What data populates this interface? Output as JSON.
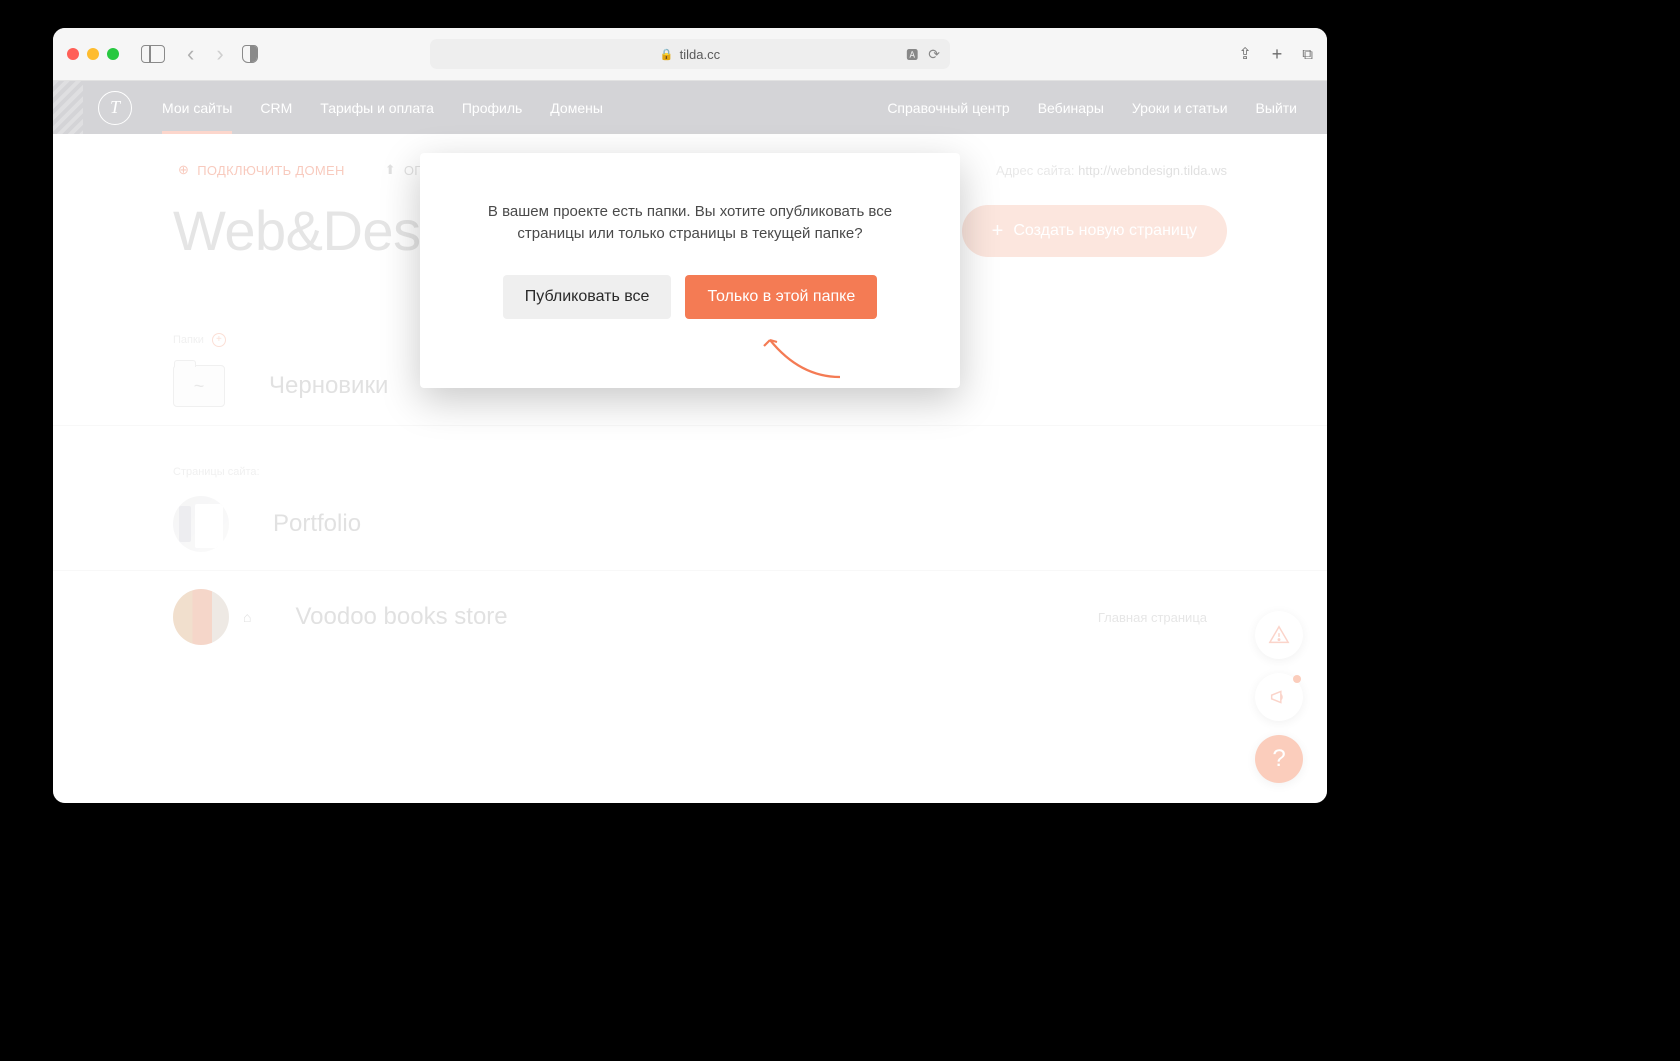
{
  "browser": {
    "url_host": "tilda.cc"
  },
  "nav": {
    "items": [
      "Мои сайты",
      "CRM",
      "Тарифы и оплата",
      "Профиль",
      "Домены"
    ],
    "right": [
      "Справочный центр",
      "Вебинары",
      "Уроки и статьи",
      "Выйти"
    ],
    "active_index": 0
  },
  "toolbar": {
    "connect_domain": "ПОДКЛЮЧИТЬ ДОМЕН",
    "publish_prefix": "ОП",
    "site_url_label": "Адрес сайта:",
    "site_url": "http://webndesign.tilda.ws"
  },
  "project": {
    "title": "Web&Design",
    "create_page": "Создать новую страницу"
  },
  "sections": {
    "folders_label": "Папки",
    "pages_label": "Страницы сайта:"
  },
  "folders": [
    {
      "name": "Черновики",
      "tilde": "~"
    }
  ],
  "pages": [
    {
      "name": "Portfolio",
      "meta": ""
    },
    {
      "name": "Voodoo books store",
      "is_home": true,
      "meta": "Главная страница"
    }
  ],
  "modal": {
    "message": "В вашем проекте есть папки. Вы хотите опубликовать все страницы или только страницы в текущей папке?",
    "publish_all": "Публиковать все",
    "only_this_folder": "Только в этой папке"
  },
  "fab": {
    "help": "?"
  }
}
